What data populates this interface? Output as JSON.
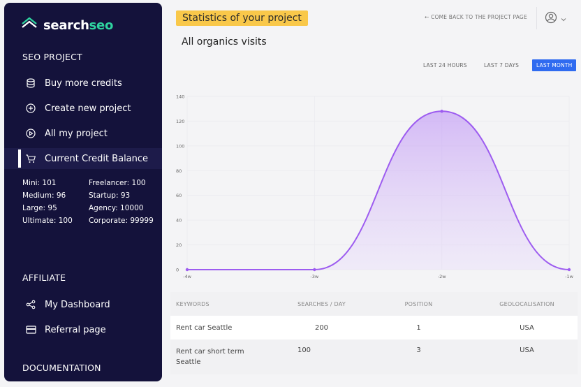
{
  "sidebar": {
    "brand_prefix": "search",
    "brand_accent": "seo",
    "section_seo": "SEO PROJECT",
    "items": [
      {
        "label": "Buy more credits",
        "icon": "database-icon"
      },
      {
        "label": "Create new project",
        "icon": "plus-circle-icon"
      },
      {
        "label": "All my project",
        "icon": "play-circle-icon"
      },
      {
        "label": "Current Credit Balance",
        "icon": "cart-icon"
      }
    ],
    "credits": [
      "Mini: 101",
      "Freelancer: 100",
      "Medium: 96",
      "Startup: 93",
      "Large: 95",
      "Agency: 10000",
      "Ultimate: 100",
      "Corporate: 99999"
    ],
    "section_affiliate": "AFFILIATE",
    "affiliate_items": [
      {
        "label": "My Dashboard",
        "icon": "share-icon"
      },
      {
        "label": "Referral page",
        "icon": "card-icon"
      }
    ],
    "section_docs": "DOCUMENTATION"
  },
  "header": {
    "title": "Statistics of your project",
    "back_link": "← COME BACK TO THE PROJECT PAGE"
  },
  "chart_title": "All organics visits",
  "ranges": [
    "LAST 24 HOURS",
    "LAST 7 DAYS",
    "LAST MONTH"
  ],
  "active_range": "LAST MONTH",
  "colors": {
    "accent": "#2f6bf0",
    "badge": "#f9c84a",
    "sidebar": "#14123b",
    "brand": "#2fd4a0",
    "line": "#9d5cf0"
  },
  "chart_data": {
    "type": "area",
    "categories": [
      "-4w",
      "-3w",
      "-2w",
      "-1w"
    ],
    "values": [
      0,
      0,
      128,
      0
    ],
    "ylim": [
      0,
      140
    ],
    "yticks": [
      0,
      20,
      40,
      60,
      80,
      100,
      120,
      140
    ],
    "grid": true,
    "title": "",
    "xlabel": "",
    "ylabel": ""
  },
  "table": {
    "headers": [
      "KEYWORDS",
      "SEARCHES / DAY",
      "POSITION",
      "GEOLOCALISATION"
    ],
    "rows": [
      {
        "keyword": "Rent car Seattle",
        "searches": "200",
        "position": "1",
        "geo": "USA"
      },
      {
        "keyword": "Rent car short term Seattle",
        "searches": "100",
        "position": "3",
        "geo": "USA"
      }
    ]
  }
}
